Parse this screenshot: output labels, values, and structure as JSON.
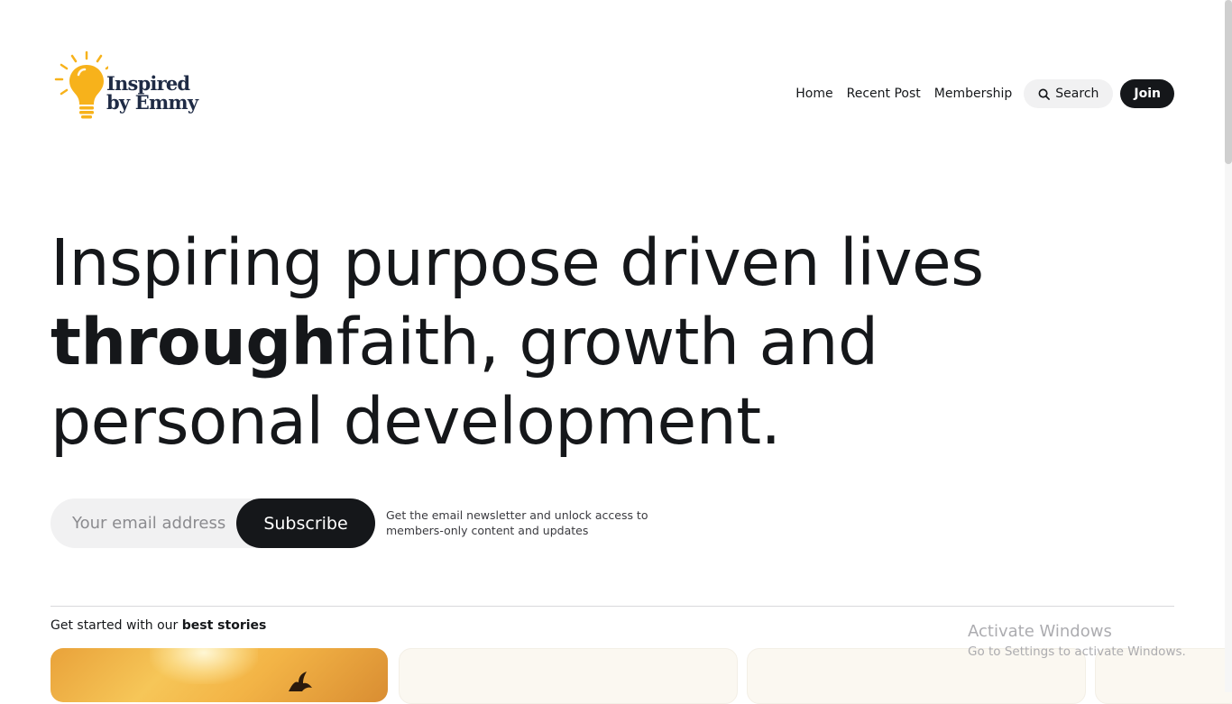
{
  "brand": {
    "line1": "Inspired",
    "line2": "by Emmy",
    "icon": "lightbulb-icon",
    "colors": {
      "bulb": "#f7b21b",
      "text": "#1f2b45"
    }
  },
  "nav": {
    "items": [
      {
        "label": "Home"
      },
      {
        "label": "Recent Post"
      },
      {
        "label": "Membership"
      }
    ],
    "search_label": "Search",
    "search_icon": "search-icon",
    "join_label": "Join"
  },
  "hero": {
    "line1": "Inspiring purpose driven lives",
    "line2_bold": "through",
    "line2_rest": "faith, growth and",
    "line3": "personal development."
  },
  "subscribe": {
    "placeholder": "Your email address",
    "button_label": "Subscribe",
    "note": "Get the email newsletter and unlock access to members-only content and updates"
  },
  "best_stories": {
    "prefix": "Get started with our ",
    "emphasis": "best stories"
  },
  "watermark": {
    "title": "Activate Windows",
    "subtitle": "Go to Settings to activate Windows."
  },
  "colors": {
    "accent": "#15171a",
    "pill_bg": "#f1f1f2",
    "card_bg": "#fbf8f1"
  }
}
